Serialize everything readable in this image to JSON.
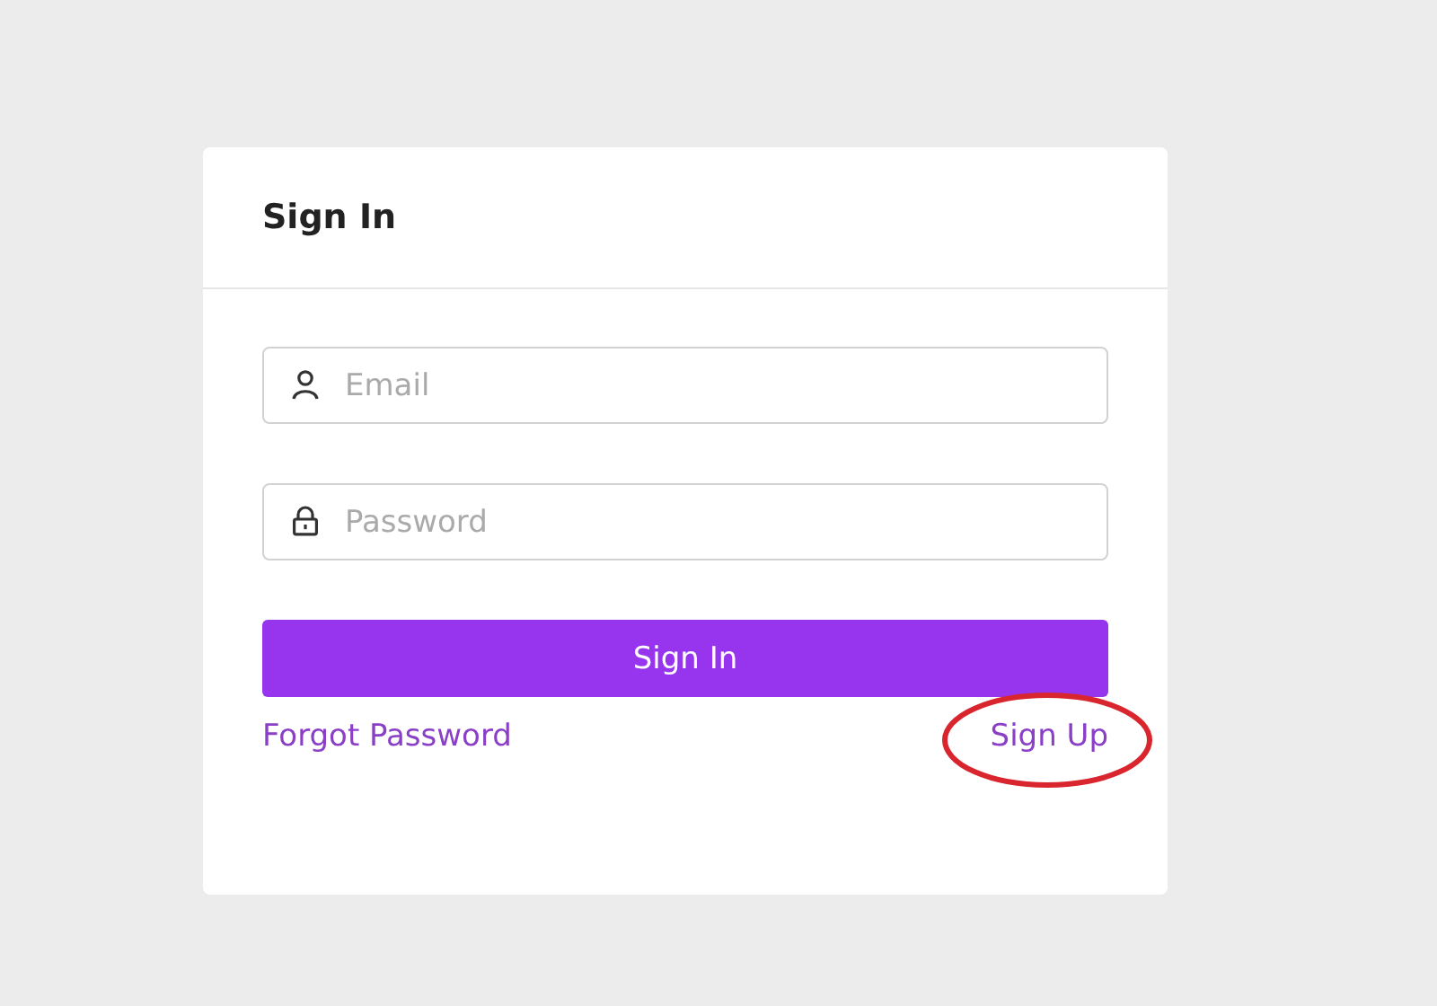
{
  "card": {
    "title": "Sign In"
  },
  "fields": [
    {
      "kind": "email",
      "placeholder": "Email"
    },
    {
      "kind": "password",
      "placeholder": "Password"
    }
  ],
  "submit": {
    "label": "Sign In"
  },
  "links": {
    "forgot": {
      "label": "Forgot Password"
    },
    "signup": {
      "label": "Sign Up",
      "highlighted": true
    }
  }
}
